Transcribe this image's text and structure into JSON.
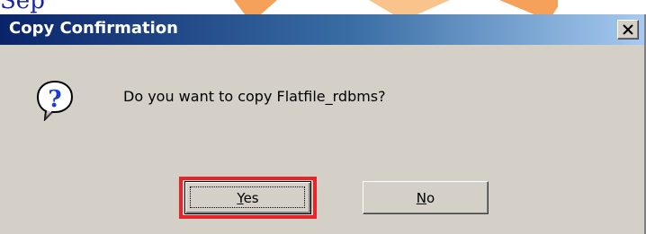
{
  "dialog": {
    "title": "Copy Confirmation",
    "close_label": "×",
    "message": "Do you want to copy Flatfile_rdbms?",
    "icon": "question-icon"
  },
  "buttons": {
    "yes": {
      "label": "Yes",
      "mnemonic": "Y",
      "rest": "es",
      "default": true,
      "highlighted": true
    },
    "no": {
      "label": "No",
      "mnemonic": "N",
      "rest": "o",
      "default": false
    }
  },
  "background": {
    "partial_text": "Sep"
  },
  "colors": {
    "dialog_face": "#d4d0c8",
    "title_start": "#0a246a",
    "title_end": "#a6caf0",
    "highlight": "#e8232a",
    "icon_blue": "#1a3bd6"
  }
}
